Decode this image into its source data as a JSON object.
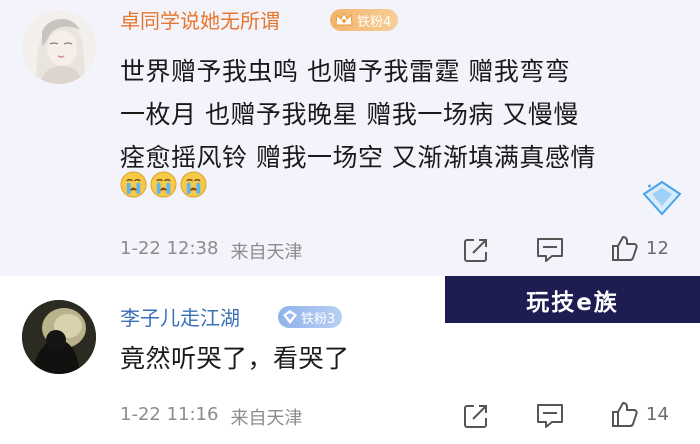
{
  "comments": [
    {
      "username": "卓同学说她无所谓",
      "badge": "铁粉4",
      "lines": [
        "世界赠予我虫鸣 也赠予我雷霆  赠我弯弯",
        "一枚月 也赠予我晚星 赠我一场病 又慢慢",
        "痊愈摇风铃 赠我一场空 又渐渐填满真感情"
      ],
      "emojis": [
        "crying-face-emoji",
        "crying-face-emoji",
        "crying-face-emoji"
      ],
      "date": "1-22 12:38",
      "location": "来自天津",
      "likes": "12"
    },
    {
      "username": "李子儿走江湖",
      "badge": "铁粉3",
      "text": "竟然听哭了，看哭了",
      "date": "1-22 11:16",
      "location": "来自天津",
      "likes": "14"
    }
  ],
  "watermark": "玩技e族",
  "colors": {
    "highlight_bg": "#f3f3fc",
    "username_orange": "#e8772e",
    "username_blue": "#3b6fb6",
    "meta_gray": "#8c8c8c",
    "watermark_bg": "#1d1d52"
  },
  "icons": [
    "share-icon",
    "reply-icon",
    "like-icon",
    "gem-decoration-icon",
    "crown-icon",
    "diamond-icon"
  ]
}
